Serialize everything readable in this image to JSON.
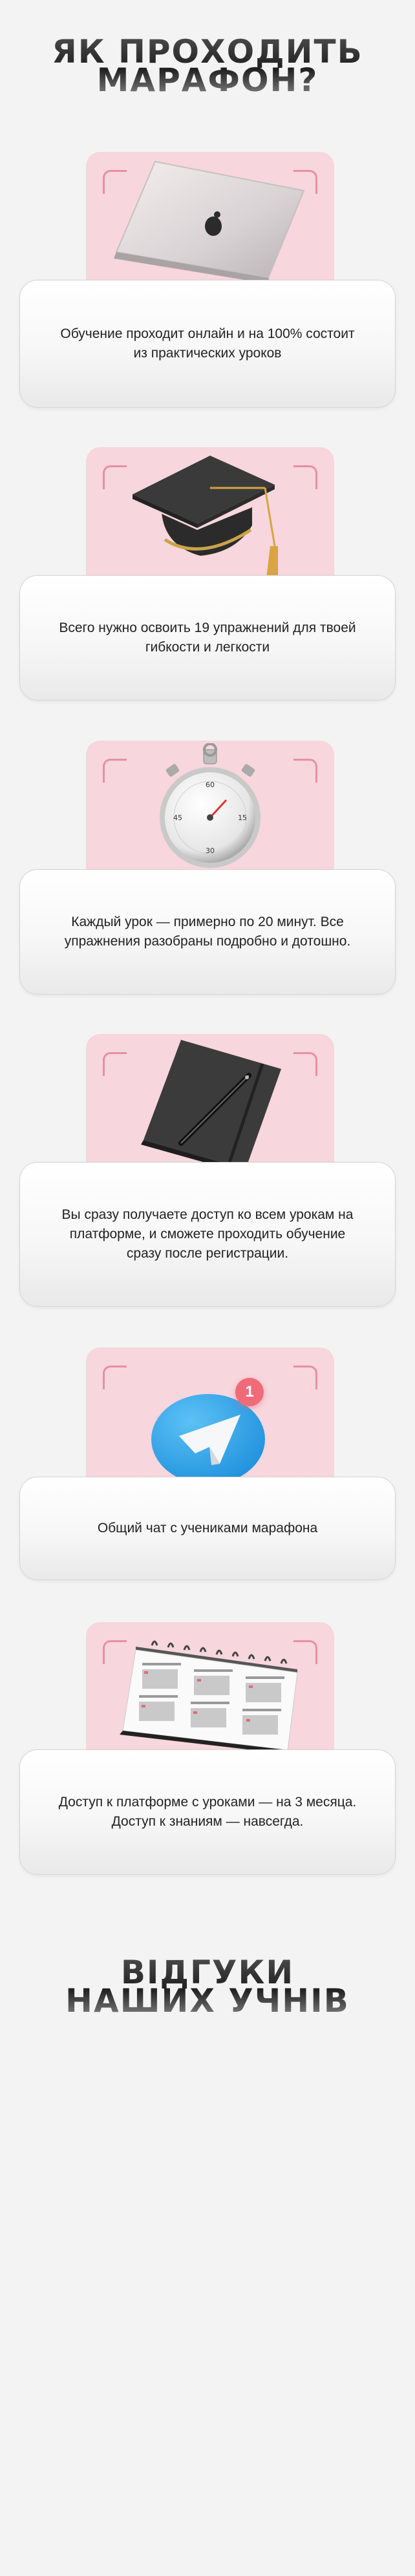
{
  "heading_top": {
    "line1": "ЯК ПРОХОДИТЬ",
    "line2": "МАРАФОН?"
  },
  "steps": [
    {
      "icon": "laptop-icon",
      "text": "Обучение проходит онлайн и на 100% состоит из практических уроков"
    },
    {
      "icon": "graduation-cap-icon",
      "text": "Всего нужно освоить 19 упражнений для твоей гибкости и легкости"
    },
    {
      "icon": "stopwatch-icon",
      "text": "Каждый урок — примерно по 20 минут. Все упражнения разобраны подробно и дотошно."
    },
    {
      "icon": "notebook-pen-icon",
      "text": "Вы сразу получаете доступ ко всем урокам на платформе, и сможете проходить обучение сразу после регистрации."
    },
    {
      "icon": "telegram-icon",
      "text": "Общий чат с учениками марафона",
      "badge": "1"
    },
    {
      "icon": "calendar-icon",
      "text": "Доступ к платформе с уроками — на 3 месяца. Доступ к знаниям — навсегда."
    }
  ],
  "heading_bottom": {
    "line1": "ВІДГУКИ",
    "line2": "НАШИХ УЧНІВ"
  },
  "colors": {
    "panel": "#f7d6dd",
    "corner": "#e88fa3",
    "background": "#f3f3f3",
    "badge": "#f06b78",
    "telegram": "#2aa0e6"
  }
}
